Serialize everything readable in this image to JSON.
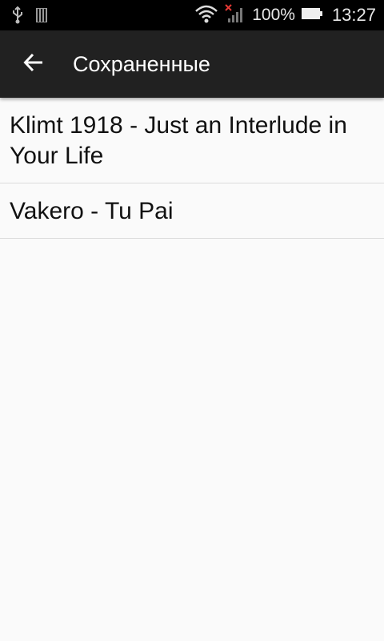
{
  "status_bar": {
    "battery_percent": "100%",
    "time": "13:27",
    "icons": [
      "usb-icon",
      "sd-card-icon",
      "wifi-icon",
      "signal-no-sim-icon",
      "battery-icon"
    ]
  },
  "app_bar": {
    "title": "Сохраненные",
    "back_icon": "arrow-back-icon"
  },
  "list": {
    "items": [
      {
        "label": "Klimt 1918 - Just an Interlude in Your Life"
      },
      {
        "label": "Vakero - Tu Pai"
      }
    ]
  },
  "colors": {
    "status_bar_bg": "#000000",
    "app_bar_bg": "#212121",
    "background": "#fafafa",
    "divider": "#dcdcdc"
  }
}
